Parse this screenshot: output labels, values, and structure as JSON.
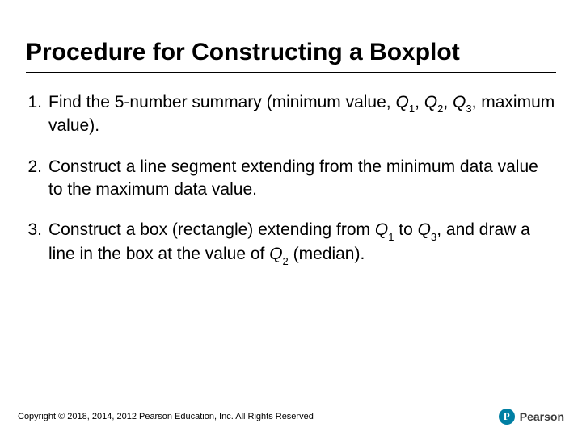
{
  "title": "Procedure for Constructing a Boxplot",
  "items": [
    {
      "num": "1.",
      "html": "Find the 5-number summary (minimum value, <span class='it'>Q</span><span class='sub'>1</span>, <span class='it'>Q</span><span class='sub'>2</span>, <span class='it'>Q</span><span class='sub'>3</span>, maximum value)."
    },
    {
      "num": "2.",
      "html": "Construct a line segment extending from the minimum data value to the maximum data value."
    },
    {
      "num": "3.",
      "html": "Construct a box (rectangle) extending from <span class='it'>Q</span><span class='sub'>1</span> to <span class='it'>Q</span><span class='sub'>3</span>, and draw a line in the box at the value of <span class='it'>Q</span><span class='sub'>2</span> (median)."
    }
  ],
  "footer": {
    "copyright": "Copyright © 2018, 2014, 2012 Pearson Education, Inc. All Rights Reserved",
    "brand": "Pearson",
    "logo_letter": "P"
  }
}
